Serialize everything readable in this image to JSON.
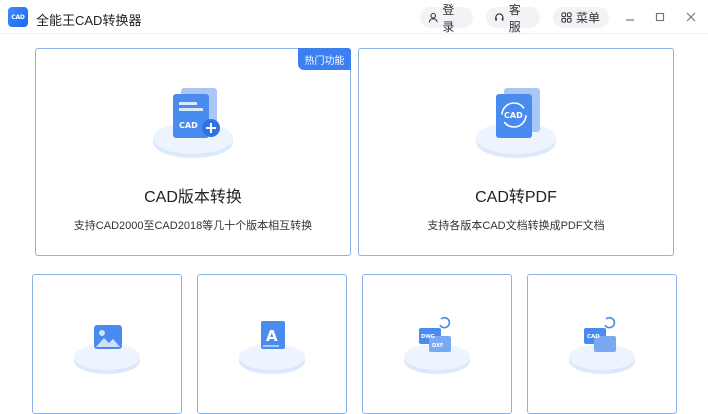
{
  "app": {
    "title": "全能王CAD转换器",
    "logo_text": "CAD"
  },
  "header": {
    "login_label": "登录",
    "service_label": "客服",
    "menu_label": "菜单"
  },
  "cards": [
    {
      "title": "CAD版本转换",
      "desc": "支持CAD2000至CAD2018等几十个版本相互转换",
      "badge": "热门功能",
      "icon": "cad-version-icon"
    },
    {
      "title": "CAD转PDF",
      "desc": "支持各版本CAD文档转换成PDF文档",
      "icon": "cad-to-pdf-icon"
    }
  ],
  "small_cards": [
    {
      "icon": "image-icon"
    },
    {
      "icon": "text-icon"
    },
    {
      "icon": "dwg-dxf-convert-icon"
    },
    {
      "icon": "cad-convert-icon"
    }
  ],
  "colors": {
    "accent": "#3b7ff0",
    "border": "#8ab4e8"
  }
}
